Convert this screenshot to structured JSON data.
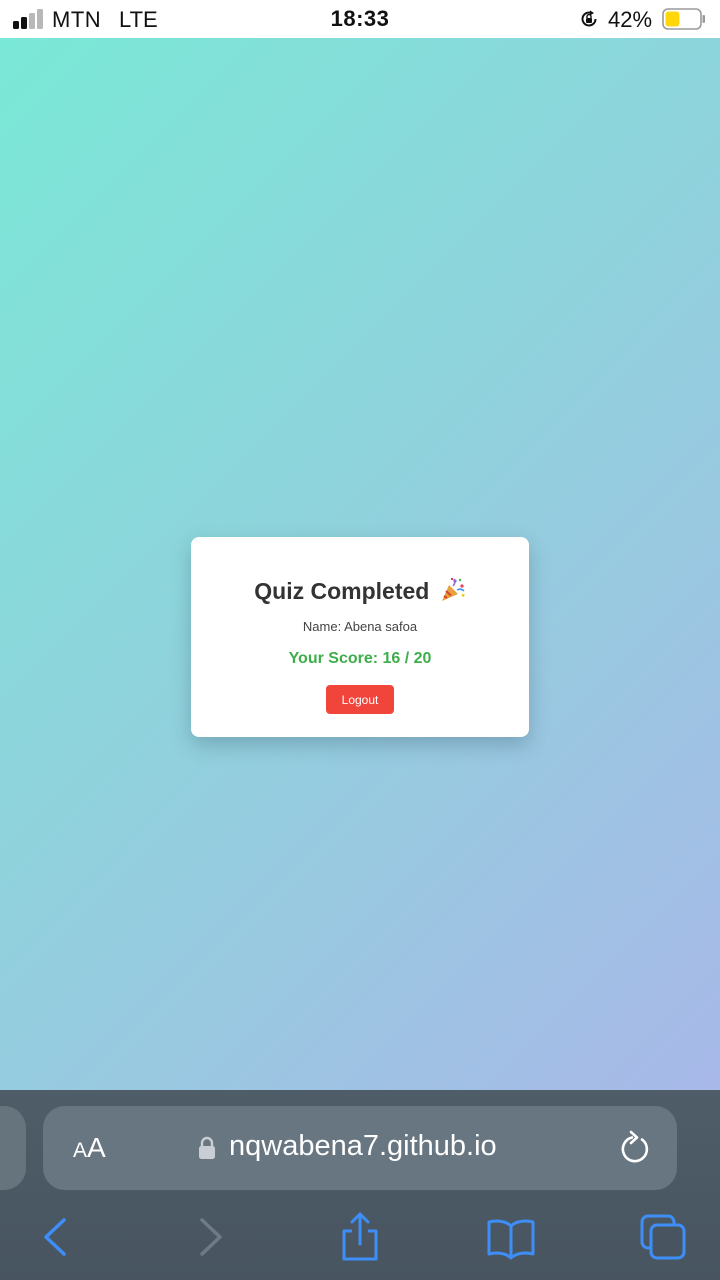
{
  "status_bar": {
    "carrier": "MTN",
    "network": "LTE",
    "time": "18:33",
    "battery_percent": "42%",
    "battery_level": 0.42,
    "signal_bars": 2,
    "signal_bars_total": 4
  },
  "card": {
    "title": "Quiz Completed",
    "title_emoji_icon": "party-popper-icon",
    "name_line": "Name: Abena safoa",
    "score_line": "Your Score: 16 / 20",
    "logout_label": "Logout"
  },
  "browser": {
    "text_size_label_small": "A",
    "text_size_label_large": "A",
    "url": "nqwabena7.github.io",
    "icons": [
      "padlock-icon",
      "reload-icon",
      "back-icon",
      "forward-icon",
      "share-icon",
      "bookmarks-icon",
      "tabs-icon"
    ]
  },
  "colors": {
    "accent_blue": "#3d8ef7",
    "score_green": "#3fae4a",
    "logout_red": "#f1453b",
    "battery_yellow": "#ffd60a"
  }
}
